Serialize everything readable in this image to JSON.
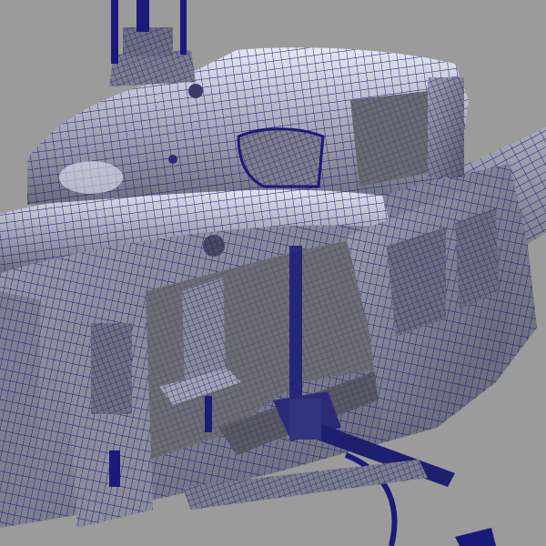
{
  "viewport": {
    "background_color": "#9b9b9b",
    "wire_color": "#1a1a7a",
    "surface_light": "#d9dbe6",
    "surface_mid": "#8a8c9e",
    "surface_dark": "#5c5e6c",
    "interior_color": "#6e6e72"
  },
  "model": {
    "subject": "helicopter-wireframe",
    "parts": [
      "antenna",
      "rotor-mast",
      "canopy",
      "cockpit-window",
      "fuselage",
      "side-doors",
      "cabin-seat",
      "door-gun",
      "tail-boom",
      "landing-skid"
    ]
  }
}
